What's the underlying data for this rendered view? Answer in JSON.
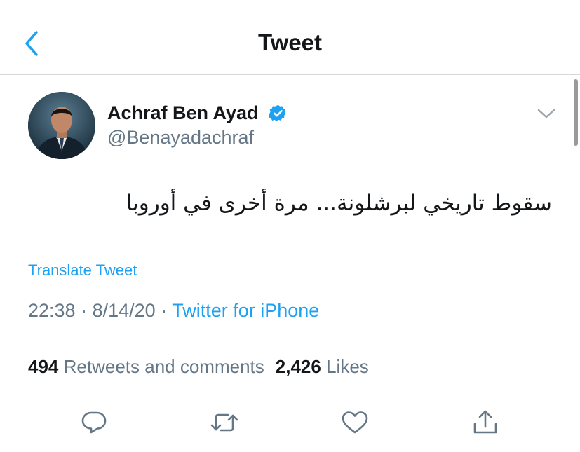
{
  "nav": {
    "title": "Tweet",
    "back_icon": "chevron-left-icon"
  },
  "author": {
    "name": "Achraf Ben Ayad",
    "handle": "@Benayadachraf",
    "verified": true
  },
  "tweet": {
    "text": "سقوط تاريخي لبرشلونة... مرة أخرى في أوروبا",
    "translate_label": "Translate Tweet",
    "time": "22:38",
    "separator": "·",
    "date": "8/14/20",
    "source": "Twitter for iPhone"
  },
  "stats": {
    "retweets_count": "494",
    "retweets_label": "Retweets and comments",
    "likes_count": "2,426",
    "likes_label": "Likes"
  },
  "actions": [
    "reply-icon",
    "retweet-icon",
    "like-icon",
    "share-icon"
  ],
  "colors": {
    "accent": "#1da1f2",
    "text": "#14171a",
    "secondary": "#657786",
    "divider": "#d6d9db"
  }
}
